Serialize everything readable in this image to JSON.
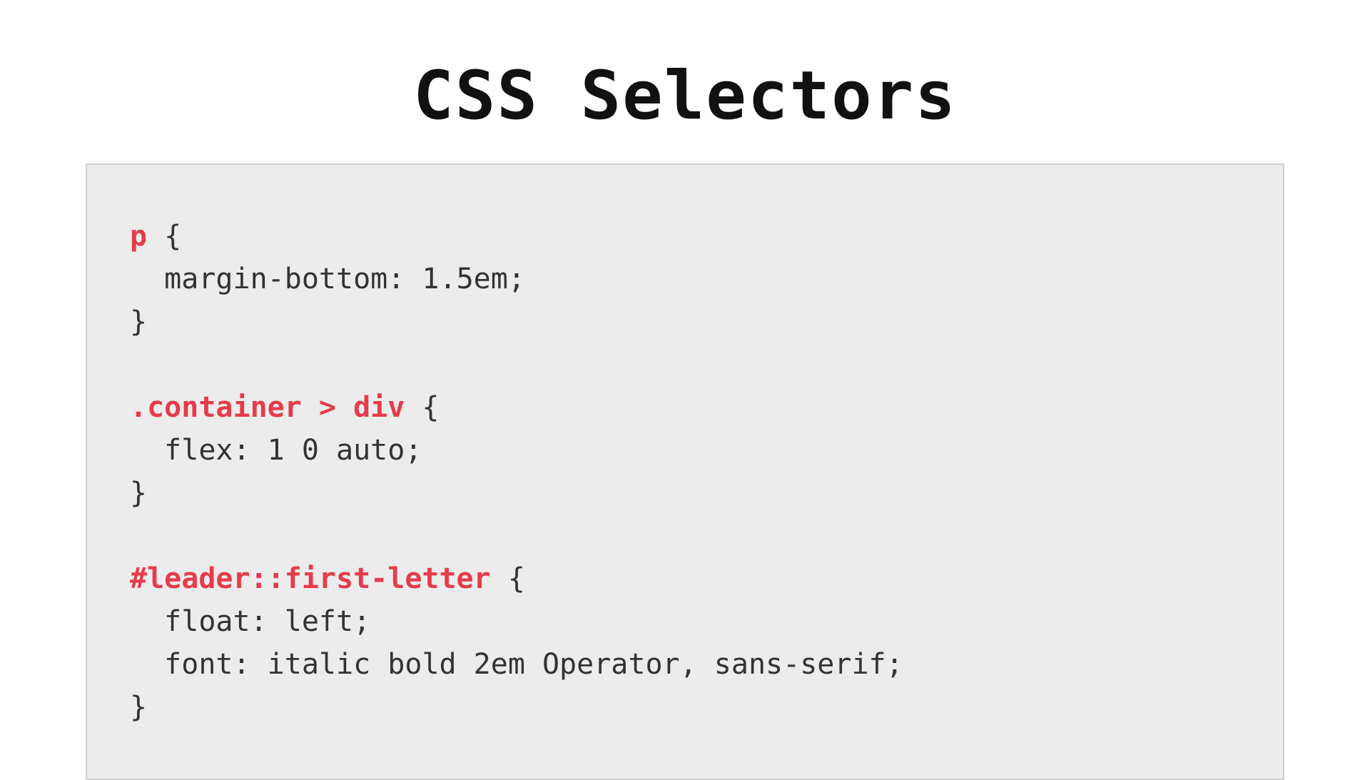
{
  "title": "CSS Selectors",
  "code": {
    "rules": [
      {
        "selector": "p",
        "declarations": [
          "margin-bottom: 1.5em;"
        ]
      },
      {
        "selector": ".container > div",
        "declarations": [
          "flex: 1 0 auto;"
        ]
      },
      {
        "selector": "#leader::first-letter",
        "declarations": [
          "float: left;",
          "font: italic bold 2em Operator, sans-serif;"
        ]
      }
    ]
  },
  "colors": {
    "selector": "#e63b4a",
    "code_bg": "#ececec",
    "code_border": "#cfcfcf",
    "text": "#333333"
  }
}
